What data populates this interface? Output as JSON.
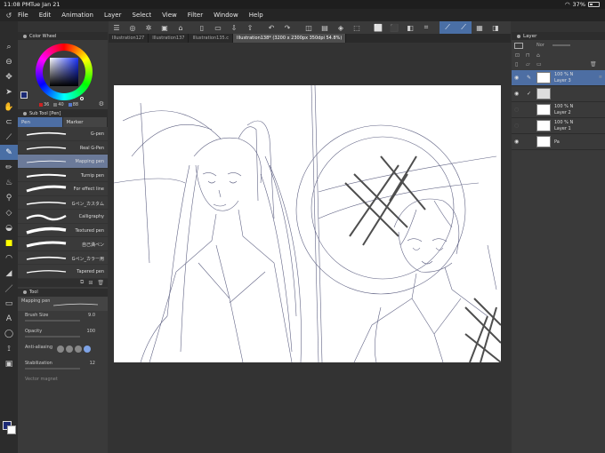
{
  "status": {
    "time": "11:08 PM",
    "date": "Tue Jan 21",
    "battery": "37%"
  },
  "menu": [
    "File",
    "Edit",
    "Animation",
    "Layer",
    "Select",
    "View",
    "Filter",
    "Window",
    "Help"
  ],
  "tabs": [
    {
      "label": "Illustration127",
      "active": false
    },
    {
      "label": "Illustration137",
      "active": false
    },
    {
      "label": "Illustration135.c",
      "active": false
    },
    {
      "label": "Illustration138* (3200 x 2300px 350dpi 54.8%)",
      "active": true
    }
  ],
  "color_panel": {
    "title": "Color Wheel",
    "h": "36",
    "s": "40",
    "v": "88",
    "current_color": "#1c2a75"
  },
  "sub_tool": {
    "title": "Sub Tool [Pen]",
    "tabs": [
      "Pen",
      "Marker"
    ],
    "brushes": [
      {
        "label": "G-pen",
        "selected": false
      },
      {
        "label": "Real G-Pen",
        "selected": false
      },
      {
        "label": "Mapping pen",
        "selected": true
      },
      {
        "label": "Turnip pen",
        "selected": false
      },
      {
        "label": "For effect line",
        "selected": false
      },
      {
        "label": "Gペン_カスタム",
        "selected": false
      },
      {
        "label": "Calligraphy",
        "selected": false
      },
      {
        "label": "Textured pen",
        "selected": false
      },
      {
        "label": "自己満ペン",
        "selected": false
      },
      {
        "label": "Gペン_カラー用",
        "selected": false
      },
      {
        "label": "Tapered pen",
        "selected": false
      }
    ]
  },
  "tool_property": {
    "title": "Tool",
    "current_tool": "Mapping pen",
    "brush_size_label": "Brush Size",
    "brush_size": "9.0",
    "opacity_label": "Opacity",
    "opacity": "100",
    "anti_aliasing_label": "Anti-aliasing",
    "stabilization_label": "Stabilization",
    "stabilization": "12",
    "vector_magnet_label": "Vector magnet"
  },
  "layer_panel": {
    "title": "Layer",
    "blend_label": "Nor",
    "layers": [
      {
        "name": "Layer 3",
        "opacity": "100 % N",
        "visible": true,
        "selected": true
      },
      {
        "name": "",
        "opacity": "",
        "visible": true,
        "selected": false
      },
      {
        "name": "Layer 2",
        "opacity": "100 % N",
        "visible": false,
        "selected": false
      },
      {
        "name": "Layer 1",
        "opacity": "100 % N",
        "visible": false,
        "selected": false
      },
      {
        "name": "Pa",
        "opacity": "",
        "visible": true,
        "selected": false
      }
    ]
  },
  "colors": {
    "accent": "#4a6fa5",
    "sketch_ink": "#3a3d66"
  }
}
